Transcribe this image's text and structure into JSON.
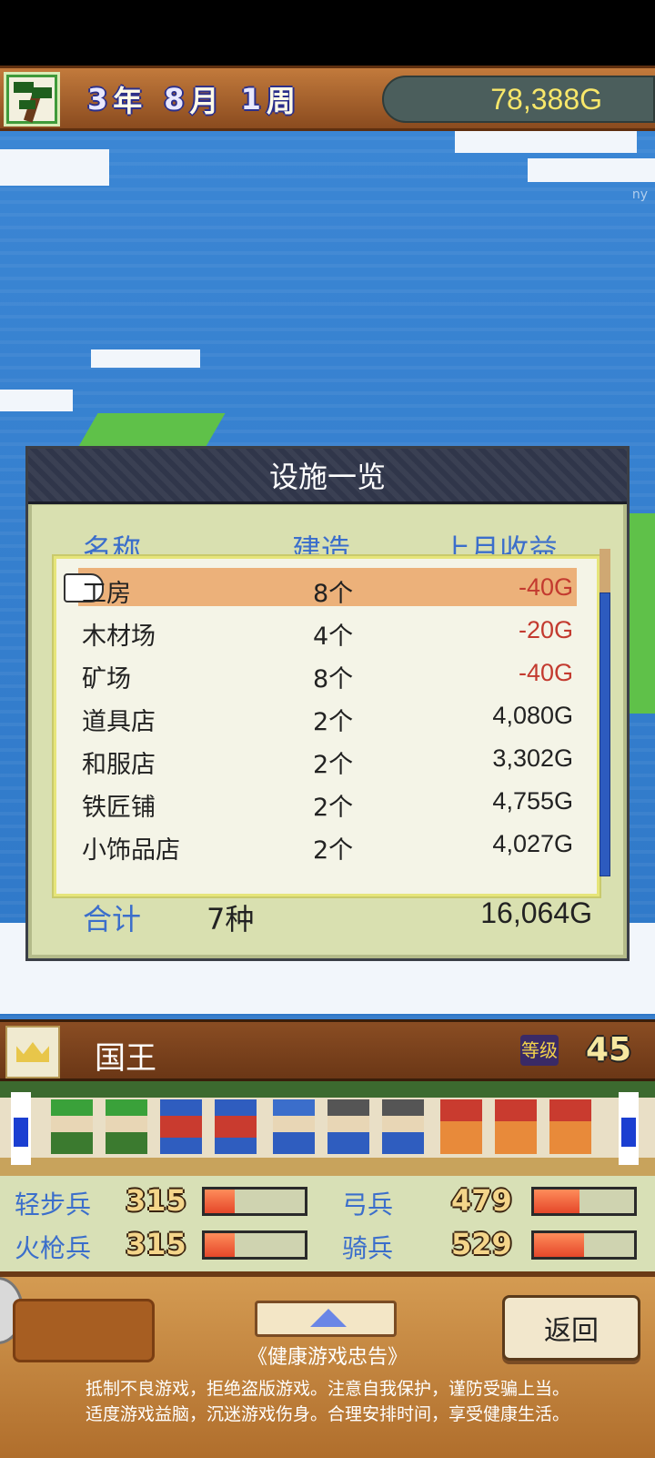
{
  "date": {
    "year_num": "3",
    "year_unit": "年",
    "month_num": "8",
    "month_unit": "月",
    "week_num": "1",
    "week_unit": "周"
  },
  "gold": "78,388G",
  "watermark": "ny",
  "panel": {
    "title": "设施一览",
    "col_name": "名称",
    "col_build": "建造",
    "col_income": "上月收益",
    "rows": [
      {
        "name": "工房",
        "count": "8个",
        "income": "-40G"
      },
      {
        "name": "木材场",
        "count": "4个",
        "income": "-20G"
      },
      {
        "name": "矿场",
        "count": "8个",
        "income": "-40G"
      },
      {
        "name": "道具店",
        "count": "2个",
        "income": "4,080G"
      },
      {
        "name": "和服店",
        "count": "2个",
        "income": "3,302G"
      },
      {
        "name": "铁匠铺",
        "count": "2个",
        "income": "4,755G"
      },
      {
        "name": "小饰品店",
        "count": "2个",
        "income": "4,027G"
      }
    ],
    "total_label": "合计",
    "total_kinds": "7种",
    "total_value": "16,064G",
    "accent": "#3b6ecb",
    "negative_color": "#c33a2f"
  },
  "king": {
    "title": "国王",
    "level_label": "等级",
    "level": "45"
  },
  "troops": [
    {
      "label": "轻步兵",
      "value": "315",
      "fill": 0.3
    },
    {
      "label": "弓兵",
      "value": "479",
      "fill": 0.45
    },
    {
      "label": "火枪兵",
      "value": "315",
      "fill": 0.3
    },
    {
      "label": "骑兵",
      "value": "529",
      "fill": 0.5
    }
  ],
  "bottom": {
    "back_label": "返回",
    "health_title": "《健康游戏忠告》",
    "health_line1": "抵制不良游戏，拒绝盗版游戏。注意自我保护，谨防受骗上当。",
    "health_line2": "适度游戏益脑，沉迷游戏伤身。合理安排时间，享受健康生活。"
  }
}
